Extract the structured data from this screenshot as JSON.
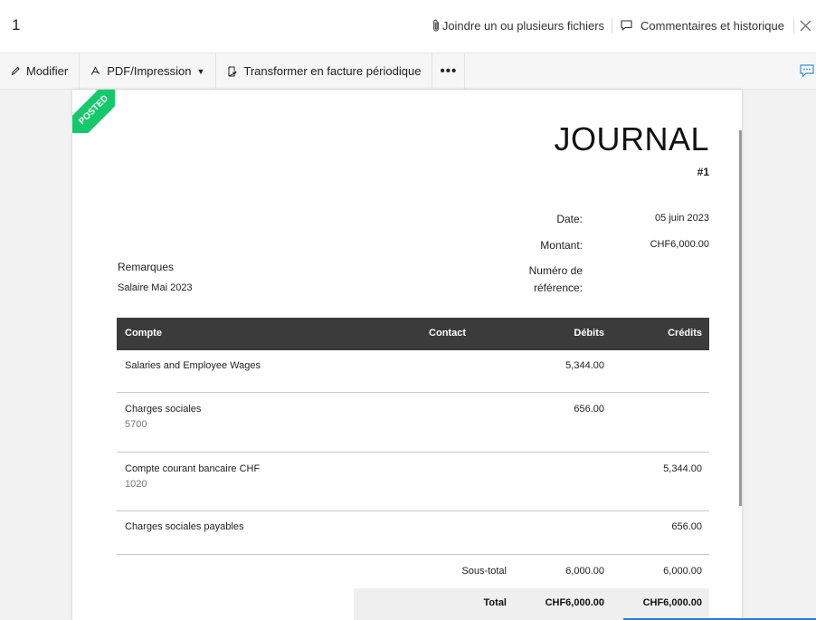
{
  "header": {
    "page_number": "1",
    "attach_label": "Joindre un ou plusieurs fichiers",
    "comments_label": "Commentaires et historique"
  },
  "toolbar": {
    "edit_label": "Modifier",
    "pdf_label": "PDF/Impression",
    "transform_label": "Transformer en facture périodique",
    "more_label": "•••"
  },
  "document": {
    "ribbon_label": "POSTED",
    "title": "JOURNAL",
    "number": "#1",
    "date_label": "Date:",
    "date_value": "05 juin 2023",
    "amount_label": "Montant:",
    "amount_value": "CHF6,000.00",
    "reference_label_1": "Numéro de",
    "reference_label_2": "référence:",
    "remarks_label": "Remarques",
    "remarks_value": "Salaire Mai 2023",
    "columns": {
      "account": "Compte",
      "contact": "Contact",
      "debits": "Débits",
      "credits": "Crédits"
    },
    "rows": [
      {
        "account": "Salaries and Employee Wages",
        "code": "",
        "debit": "5,344.00",
        "credit": ""
      },
      {
        "account": "Charges sociales",
        "code": "5700",
        "debit": "656.00",
        "credit": ""
      },
      {
        "account": "Compte courant bancaire CHF",
        "code": "1020",
        "debit": "",
        "credit": "5,344.00"
      },
      {
        "account": "Charges sociales payables",
        "code": "",
        "debit": "",
        "credit": "656.00"
      }
    ],
    "subtotal_label": "Sous-total",
    "subtotal_debit": "6,000.00",
    "subtotal_credit": "6,000.00",
    "total_label": "Total",
    "total_debit": "CHF6,000.00",
    "total_credit": "CHF6,000.00"
  },
  "colors": {
    "ribbon": "#14c96a",
    "table_header": "#3b3b3b",
    "accent": "#2a7ad2"
  }
}
